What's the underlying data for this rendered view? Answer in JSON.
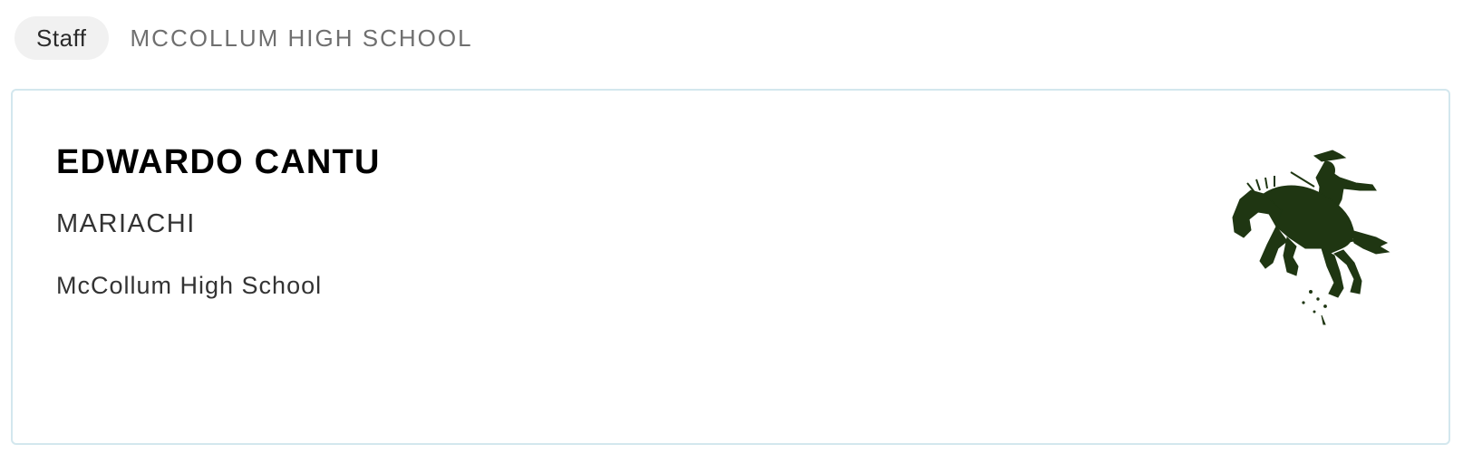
{
  "header": {
    "category_label": "Staff",
    "school_title": "MCCOLLUM HIGH SCHOOL"
  },
  "card": {
    "name": "EDWARDO CANTU",
    "role": "MARIACHI",
    "school": "McCollum High School",
    "logo_icon": "bronco-rider-logo-icon"
  },
  "colors": {
    "logo_green": "#1f3612",
    "card_border": "#d3e7ee",
    "pill_bg": "#f1f1f1"
  }
}
